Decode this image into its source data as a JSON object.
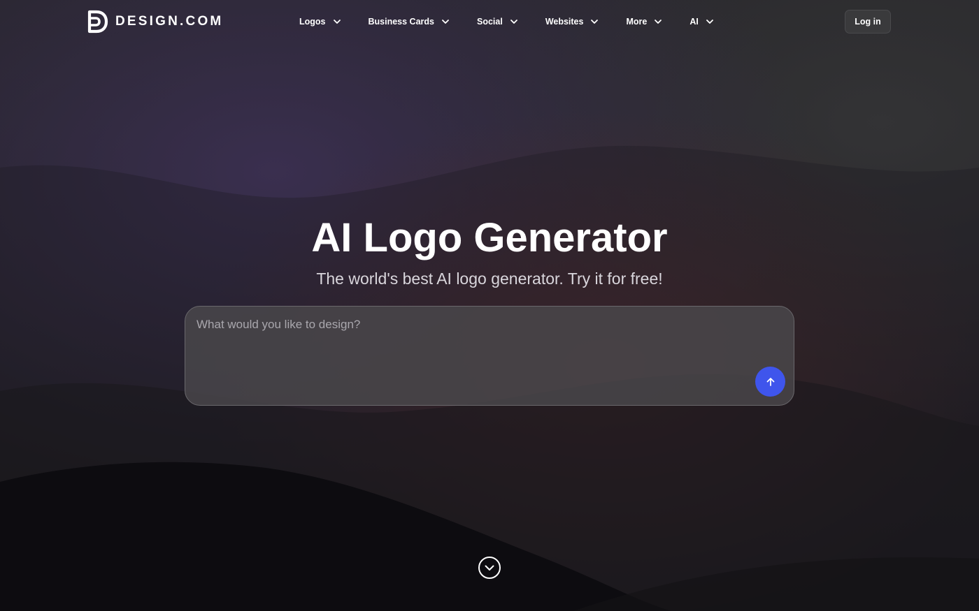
{
  "brand": {
    "name": "DESIGN.COM",
    "logo_icon": "design-com-d-logo-icon"
  },
  "nav": {
    "items": [
      {
        "label": "Logos",
        "icon": "chevron-down-icon"
      },
      {
        "label": "Business Cards",
        "icon": "chevron-down-icon"
      },
      {
        "label": "Social",
        "icon": "chevron-down-icon"
      },
      {
        "label": "Websites",
        "icon": "chevron-down-icon"
      },
      {
        "label": "More",
        "icon": "chevron-down-icon"
      },
      {
        "label": "AI",
        "icon": "chevron-down-icon"
      }
    ],
    "login_label": "Log in"
  },
  "hero": {
    "title": "AI Logo Generator",
    "subtitle": "The world's best AI logo generator. Try it for free!"
  },
  "prompt": {
    "placeholder": "What would you like to design?",
    "value": "",
    "submit_icon": "arrow-up-icon"
  },
  "scroll_hint": {
    "icon": "circle-chevron-down-icon"
  },
  "colors": {
    "background": "#141217",
    "accent": "#3f55ec",
    "input_bg": "#4a484c",
    "button_bg": "#3a3a3c"
  }
}
